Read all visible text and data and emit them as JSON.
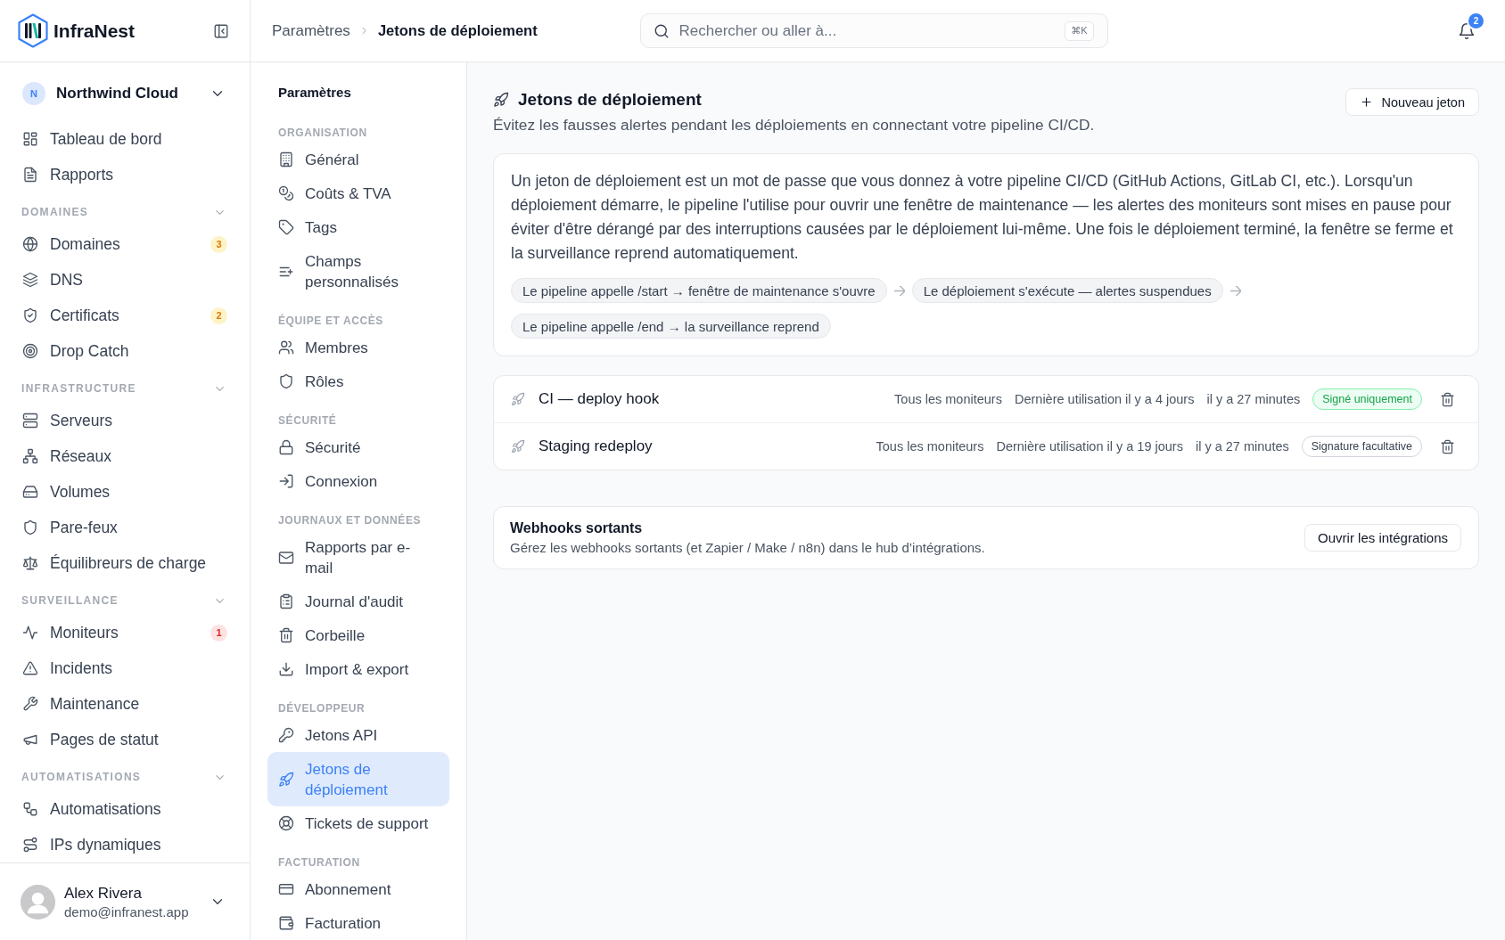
{
  "app": {
    "name": "InfraNest"
  },
  "topbar": {
    "breadcrumb": [
      {
        "label": "Paramètres",
        "current": false
      },
      {
        "label": "Jetons de déploiement",
        "current": true
      }
    ],
    "search": {
      "placeholder": "Rechercher ou aller à...",
      "shortcut": "⌘K"
    },
    "notifications": {
      "count": "2"
    }
  },
  "sidebar": {
    "workspace": {
      "initial": "N",
      "name": "Northwind Cloud"
    },
    "items": [
      {
        "label": "Tableau de bord",
        "selected": false
      },
      {
        "label": "Rapports",
        "selected": false
      }
    ],
    "sections": [
      {
        "title": "DOMAINES",
        "expanded": true,
        "items": [
          {
            "label": "Domaines",
            "selected": false,
            "badge": {
              "text": "3",
              "kind": "warning"
            }
          },
          {
            "label": "DNS",
            "selected": false
          },
          {
            "label": "Certificats",
            "selected": false,
            "badge": {
              "text": "2",
              "kind": "warning"
            }
          },
          {
            "label": "Drop Catch",
            "selected": false
          }
        ]
      },
      {
        "title": "INFRASTRUCTURE",
        "expanded": true,
        "items": [
          {
            "label": "Serveurs",
            "selected": false
          },
          {
            "label": "Réseaux",
            "selected": false
          },
          {
            "label": "Volumes",
            "selected": false
          },
          {
            "label": "Pare-feux",
            "selected": false
          },
          {
            "label": "Équilibreurs de charge",
            "selected": false
          }
        ]
      },
      {
        "title": "SURVEILLANCE",
        "expanded": true,
        "items": [
          {
            "label": "Moniteurs",
            "selected": false,
            "badge": {
              "text": "1",
              "kind": "danger"
            }
          },
          {
            "label": "Incidents",
            "selected": false
          },
          {
            "label": "Maintenance",
            "selected": false
          },
          {
            "label": "Pages de statut",
            "selected": false
          }
        ]
      },
      {
        "title": "AUTOMATISATIONS",
        "expanded": true,
        "items": [
          {
            "label": "Automatisations",
            "selected": false
          },
          {
            "label": "IPs dynamiques",
            "selected": false
          }
        ]
      }
    ],
    "user": {
      "name": "Alex Rivera",
      "email": "demo@infranest.app"
    }
  },
  "settings_nav": {
    "title": "Paramètres",
    "groups": [
      {
        "title": "ORGANISATION",
        "items": [
          {
            "label": "Général",
            "selected": false
          },
          {
            "label": "Coûts & TVA",
            "selected": false
          },
          {
            "label": "Tags",
            "selected": false
          },
          {
            "label": "Champs personnalisés",
            "selected": false
          }
        ]
      },
      {
        "title": "ÉQUIPE ET ACCÈS",
        "items": [
          {
            "label": "Membres",
            "selected": false
          },
          {
            "label": "Rôles",
            "selected": false
          }
        ]
      },
      {
        "title": "SÉCURITÉ",
        "items": [
          {
            "label": "Sécurité",
            "selected": false
          },
          {
            "label": "Connexion",
            "selected": false
          }
        ]
      },
      {
        "title": "JOURNAUX ET DONNÉES",
        "items": [
          {
            "label": "Rapports par e-mail",
            "selected": false
          },
          {
            "label": "Journal d'audit",
            "selected": false
          },
          {
            "label": "Corbeille",
            "selected": false
          },
          {
            "label": "Import & export",
            "selected": false
          }
        ]
      },
      {
        "title": "DÉVELOPPEUR",
        "items": [
          {
            "label": "Jetons API",
            "selected": false
          },
          {
            "label": "Jetons de déploiement",
            "selected": true
          },
          {
            "label": "Tickets de support",
            "selected": false
          }
        ]
      },
      {
        "title": "FACTURATION",
        "items": [
          {
            "label": "Abonnement",
            "selected": false
          },
          {
            "label": "Facturation",
            "selected": false
          }
        ]
      }
    ]
  },
  "page": {
    "title": "Jetons de déploiement",
    "subtitle": "Évitez les fausses alertes pendant les déploiements en connectant votre pipeline CI/CD.",
    "new_button": "Nouveau jeton",
    "info": {
      "text": "Un jeton de déploiement est un mot de passe que vous donnez à votre pipeline CI/CD (GitHub Actions, GitLab CI, etc.). Lorsqu'un déploiement démarre, le pipeline l'utilise pour ouvrir une fenêtre de maintenance — les alertes des moniteurs sont mises en pause pour éviter d'être dérangé par des interruptions causées par le déploiement lui-même. Une fois le déploiement terminé, la fenêtre se ferme et la surveillance reprend automatiquement.",
      "steps": [
        "Le pipeline appelle /start → fenêtre de maintenance s'ouvre",
        "Le déploiement s'exécute — alertes suspendues",
        "Le pipeline appelle /end → la surveillance reprend"
      ]
    },
    "tokens": [
      {
        "name": "CI — deploy hook",
        "scope": "Tous les moniteurs",
        "last_used": "Dernière utilisation il y a 4 jours",
        "created": "il y a 27 minutes",
        "signature": {
          "label": "Signé uniquement",
          "kind": "signed"
        }
      },
      {
        "name": "Staging redeploy",
        "scope": "Tous les moniteurs",
        "last_used": "Dernière utilisation il y a 19 jours",
        "created": "il y a 27 minutes",
        "signature": {
          "label": "Signature facultative",
          "kind": "optional"
        }
      }
    ],
    "webhooks": {
      "title": "Webhooks sortants",
      "description": "Gérez les webhooks sortants (et Zapier / Make / n8n) dans le hub d’intégrations.",
      "button": "Ouvrir les intégrations"
    }
  }
}
